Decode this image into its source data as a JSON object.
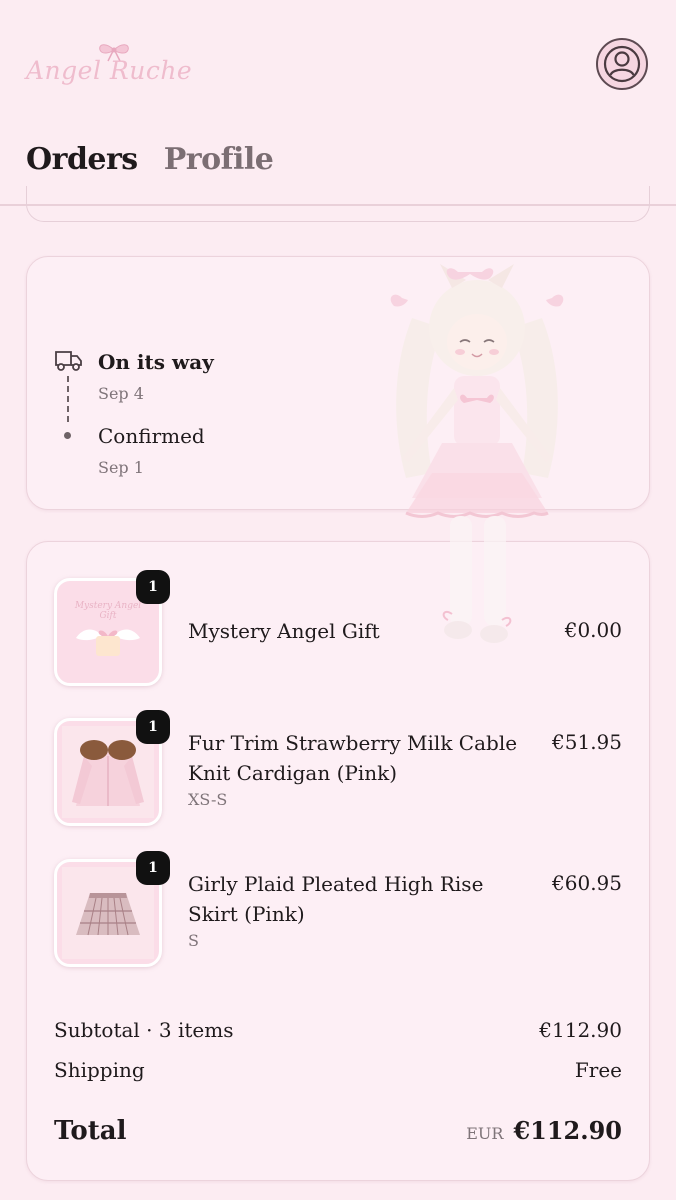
{
  "brand": {
    "logo_text": "Angel Ruche"
  },
  "header": {
    "account_icon": "account-icon"
  },
  "tabs": [
    {
      "label": "Orders",
      "active": true
    },
    {
      "label": "Profile",
      "active": false
    }
  ],
  "status": {
    "events": [
      {
        "title": "On its way",
        "date": "Sep 4",
        "icon": "delivery-truck-icon"
      },
      {
        "title": "Confirmed",
        "date": "Sep 1"
      }
    ]
  },
  "items": [
    {
      "qty": "1",
      "name": "Mystery Angel Gift",
      "variant": "",
      "price": "€0.00",
      "thumb": "gift-box-image"
    },
    {
      "qty": "1",
      "name": "Fur Trim Strawberry Milk Cable Knit Cardigan (Pink)",
      "variant": "XS-S",
      "price": "€51.95",
      "thumb": "cardigan-image"
    },
    {
      "qty": "1",
      "name": "Girly Plaid Pleated High Rise Skirt (Pink)",
      "variant": "S",
      "price": "€60.95",
      "thumb": "plaid-skirt-image"
    }
  ],
  "summary": {
    "subtotal_label": "Subtotal · 3 items",
    "subtotal_value": "€112.90",
    "shipping_label": "Shipping",
    "shipping_value": "Free",
    "total_label": "Total",
    "currency": "EUR",
    "total_value": "€112.90"
  },
  "colors": {
    "background": "#fcecf2",
    "card": "#fdeff5",
    "logo_pink": "#efbccd",
    "badge": "#111111"
  }
}
